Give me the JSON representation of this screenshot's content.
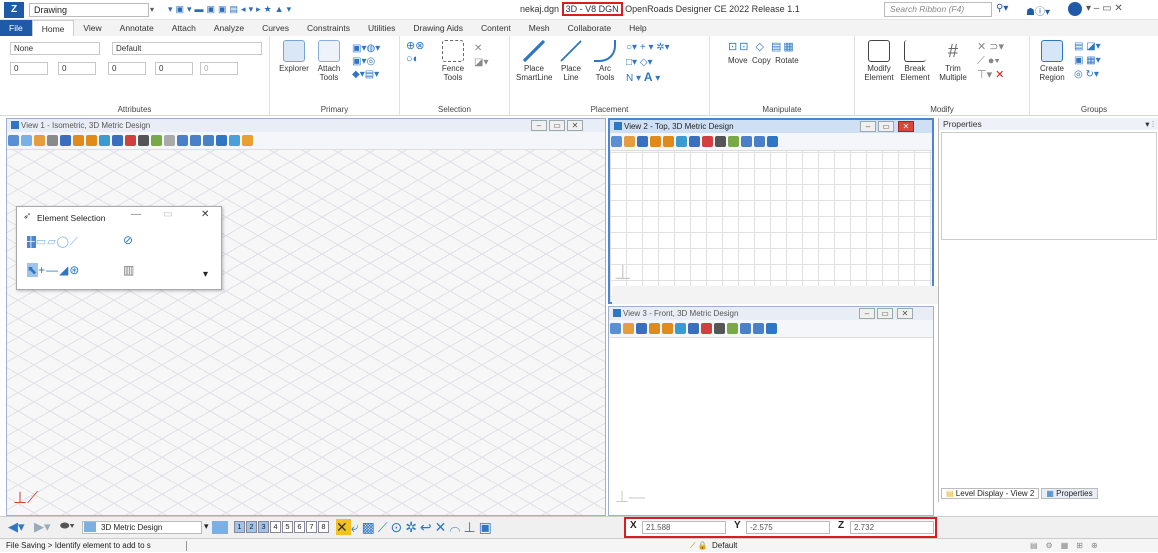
{
  "titlebar": {
    "workspace": "Drawing",
    "file": "nekaj.dgn",
    "mode": "3D - V8 DGN",
    "app": "OpenRoads Designer CE 2022 Release 1.1",
    "search_placeholder": "Search Ribbon (F4)"
  },
  "tabs": [
    "File",
    "Home",
    "View",
    "Annotate",
    "Attach",
    "Analyze",
    "Curves",
    "Constraints",
    "Utilities",
    "Drawing Aids",
    "Content",
    "Mesh",
    "Collaborate",
    "Help"
  ],
  "ribbon": {
    "attributes": {
      "level": "None",
      "style": "Default",
      "color": "0",
      "weight": "0",
      "lstyle": "0",
      "trans": "0",
      "prio": "0",
      "label": "Attributes"
    },
    "primary": {
      "explorer": "Explorer",
      "attach": "Attach",
      "tools": "Tools",
      "label": "Primary"
    },
    "selection": {
      "fence": "Fence",
      "tools": "Tools",
      "label": "Selection"
    },
    "placement": {
      "place": "Place",
      "smartline": "SmartLine",
      "line": "Line",
      "arc": "Arc",
      "tools": "Tools",
      "label": "Placement"
    },
    "manipulate": {
      "move": "Move",
      "copy": "Copy",
      "rotate": "Rotate",
      "label": "Manipulate"
    },
    "modify": {
      "modify": "Modify",
      "element": "Element",
      "break": "Break",
      "trim": "Trim",
      "multiple": "Multiple",
      "label": "Modify"
    },
    "groups": {
      "create": "Create",
      "region": "Region",
      "label": "Groups"
    }
  },
  "views": {
    "v1": "View 1 - Isometric, 3D Metric Design",
    "v2": "View 2 - Top, 3D Metric Design",
    "v3": "View 3 - Front, 3D Metric Design"
  },
  "element_selection": {
    "title": "Element Selection"
  },
  "properties": {
    "title": "Properties"
  },
  "panel_tabs": {
    "level_display": "Level Display - View 2",
    "properties": "Properties"
  },
  "bottombar": {
    "model": "3D Metric Design",
    "view_numbers": [
      "1",
      "2",
      "3",
      "4",
      "5",
      "6",
      "7",
      "8"
    ]
  },
  "coords": {
    "x_label": "X",
    "x": "21.588",
    "y_label": "Y",
    "y": "-2.575",
    "z_label": "Z",
    "z": "2.732"
  },
  "status": {
    "prompt": "File Saving > Identify element to add to s",
    "level": "Default"
  },
  "colors": {
    "accent": "#1e5aa8",
    "highlight": "#d81e1e",
    "view_border": "#9db2cf"
  }
}
